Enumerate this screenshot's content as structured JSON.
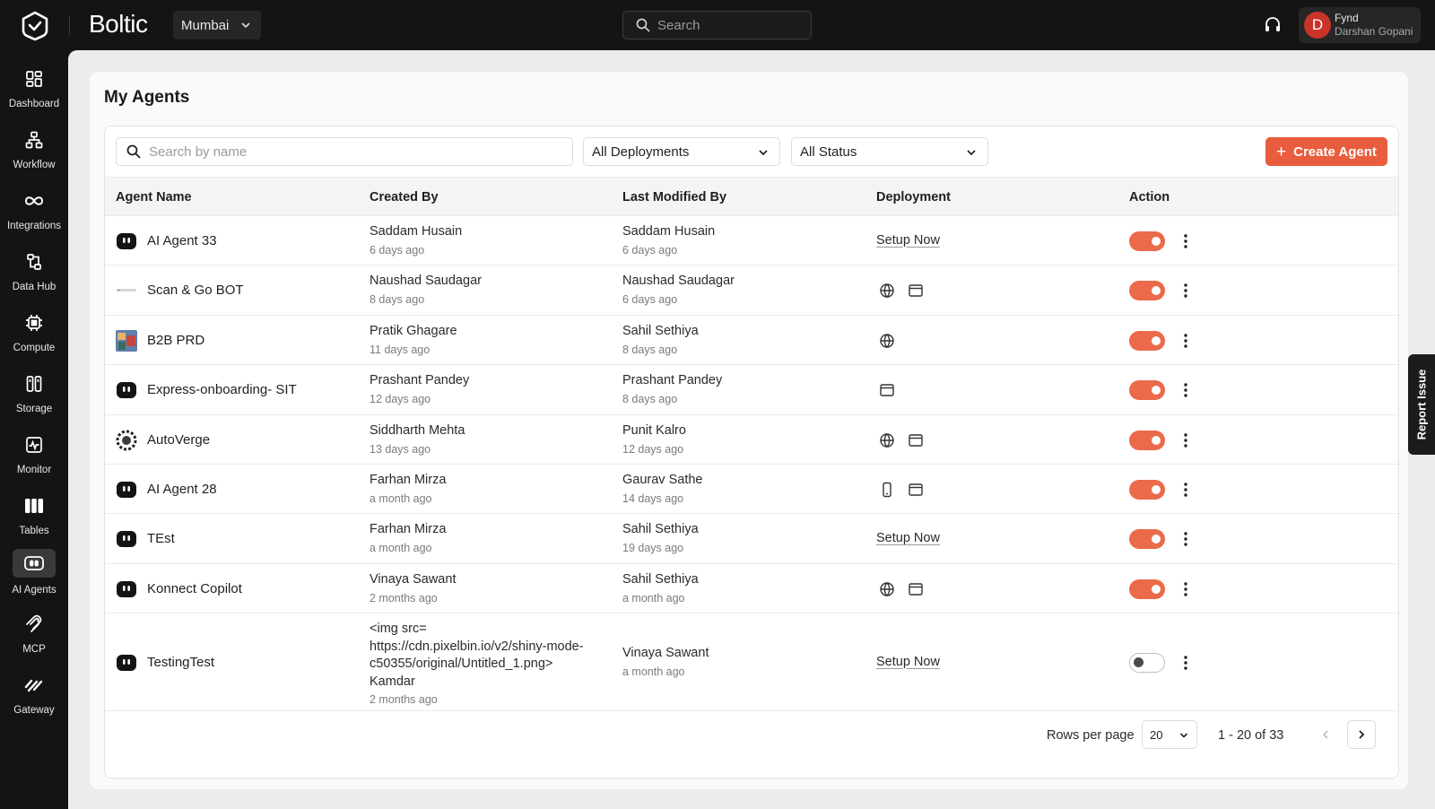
{
  "header": {
    "brand": "Boltic",
    "region": "Mumbai",
    "search_placeholder": "Search",
    "user": {
      "initial": "D",
      "org": "Fynd",
      "name": "Darshan Gopani"
    }
  },
  "sidebar": {
    "items": [
      {
        "label": "Dashboard",
        "icon": "dashboard-icon"
      },
      {
        "label": "Workflow",
        "icon": "workflow-icon"
      },
      {
        "label": "Integrations",
        "icon": "integrations-icon"
      },
      {
        "label": "Data Hub",
        "icon": "data-hub-icon"
      },
      {
        "label": "Compute",
        "icon": "compute-icon"
      },
      {
        "label": "Storage",
        "icon": "storage-icon"
      },
      {
        "label": "Monitor",
        "icon": "monitor-icon"
      },
      {
        "label": "Tables",
        "icon": "tables-icon"
      },
      {
        "label": "AI Agents",
        "icon": "ai-agents-icon",
        "active": true
      },
      {
        "label": "MCP",
        "icon": "mcp-icon"
      },
      {
        "label": "Gateway",
        "icon": "gateway-icon"
      }
    ]
  },
  "page": {
    "title": "My Agents",
    "search_placeholder": "Search by name",
    "deployment_filter": "All Deployments",
    "status_filter": "All Status",
    "create_label": "Create Agent"
  },
  "table": {
    "headers": {
      "name": "Agent Name",
      "created": "Created By",
      "modified": "Last Modified By",
      "deployment": "Deployment",
      "action": "Action"
    },
    "rows": [
      {
        "name": "AI Agent 33",
        "icon": "robot",
        "created_by": "Saddam Husain",
        "created_when": "6 days ago",
        "modified_by": "Saddam Husain",
        "modified_when": "6 days ago",
        "setup": "Setup Now",
        "deployments": [],
        "enabled": true
      },
      {
        "name": "Scan & Go BOT",
        "icon": "brand-logo",
        "created_by": "Naushad Saudagar",
        "created_when": "8 days ago",
        "modified_by": "Naushad Saudagar",
        "modified_when": "6 days ago",
        "setup": "",
        "deployments": [
          "web-globe-icon",
          "browser-window-icon"
        ],
        "enabled": true
      },
      {
        "name": "B2B PRD",
        "icon": "photo",
        "created_by": "Pratik Ghagare",
        "created_when": "11 days ago",
        "modified_by": "Sahil Sethiya",
        "modified_when": "8 days ago",
        "setup": "",
        "deployments": [
          "web-globe-icon"
        ],
        "enabled": true
      },
      {
        "name": "Express-onboarding- SIT",
        "icon": "robot",
        "created_by": "Prashant Pandey",
        "created_when": "12 days ago",
        "modified_by": "Prashant Pandey",
        "modified_when": "8 days ago",
        "setup": "",
        "deployments": [
          "browser-window-icon"
        ],
        "enabled": true
      },
      {
        "name": "AutoVerge",
        "icon": "gear-logo",
        "created_by": "Siddharth Mehta",
        "created_when": "13 days ago",
        "modified_by": "Punit Kalro",
        "modified_when": "12 days ago",
        "setup": "",
        "deployments": [
          "web-globe-icon",
          "browser-window-icon"
        ],
        "enabled": true
      },
      {
        "name": "AI Agent 28",
        "icon": "robot",
        "created_by": "Farhan Mirza",
        "created_when": "a month ago",
        "modified_by": "Gaurav Sathe",
        "modified_when": "14 days ago",
        "setup": "",
        "deployments": [
          "mobile-icon",
          "browser-window-icon"
        ],
        "enabled": true
      },
      {
        "name": "TEst",
        "icon": "robot",
        "created_by": "Farhan Mirza",
        "created_when": "a month ago",
        "modified_by": "Sahil Sethiya",
        "modified_when": "19 days ago",
        "setup": "Setup Now",
        "deployments": [],
        "enabled": true
      },
      {
        "name": "Konnect Copilot",
        "icon": "robot",
        "created_by": "Vinaya Sawant",
        "created_when": "2 months ago",
        "modified_by": "Sahil Sethiya",
        "modified_when": "a month ago",
        "setup": "",
        "deployments": [
          "web-globe-icon",
          "browser-window-icon"
        ],
        "enabled": true
      },
      {
        "name": "TestingTest",
        "icon": "robot",
        "created_by_lines": [
          "<img src=",
          "https://cdn.pixelbin.io/v2/shiny-mode-",
          "c50355/original/Untitled_1.png>",
          "Kamdar"
        ],
        "created_when": "2 months ago",
        "modified_by": "Vinaya Sawant",
        "modified_when": "a month ago",
        "setup": "Setup Now",
        "deployments": [],
        "enabled": false
      }
    ]
  },
  "pagination": {
    "rows_per_page_label": "Rows per page",
    "rows_per_page": "20",
    "range": "1 - 20 of 33"
  },
  "report_issue": "Report Issue",
  "colors": {
    "accent": "#e85d3d",
    "toggle_on": "#ea6a4a",
    "topbar": "#141414"
  }
}
